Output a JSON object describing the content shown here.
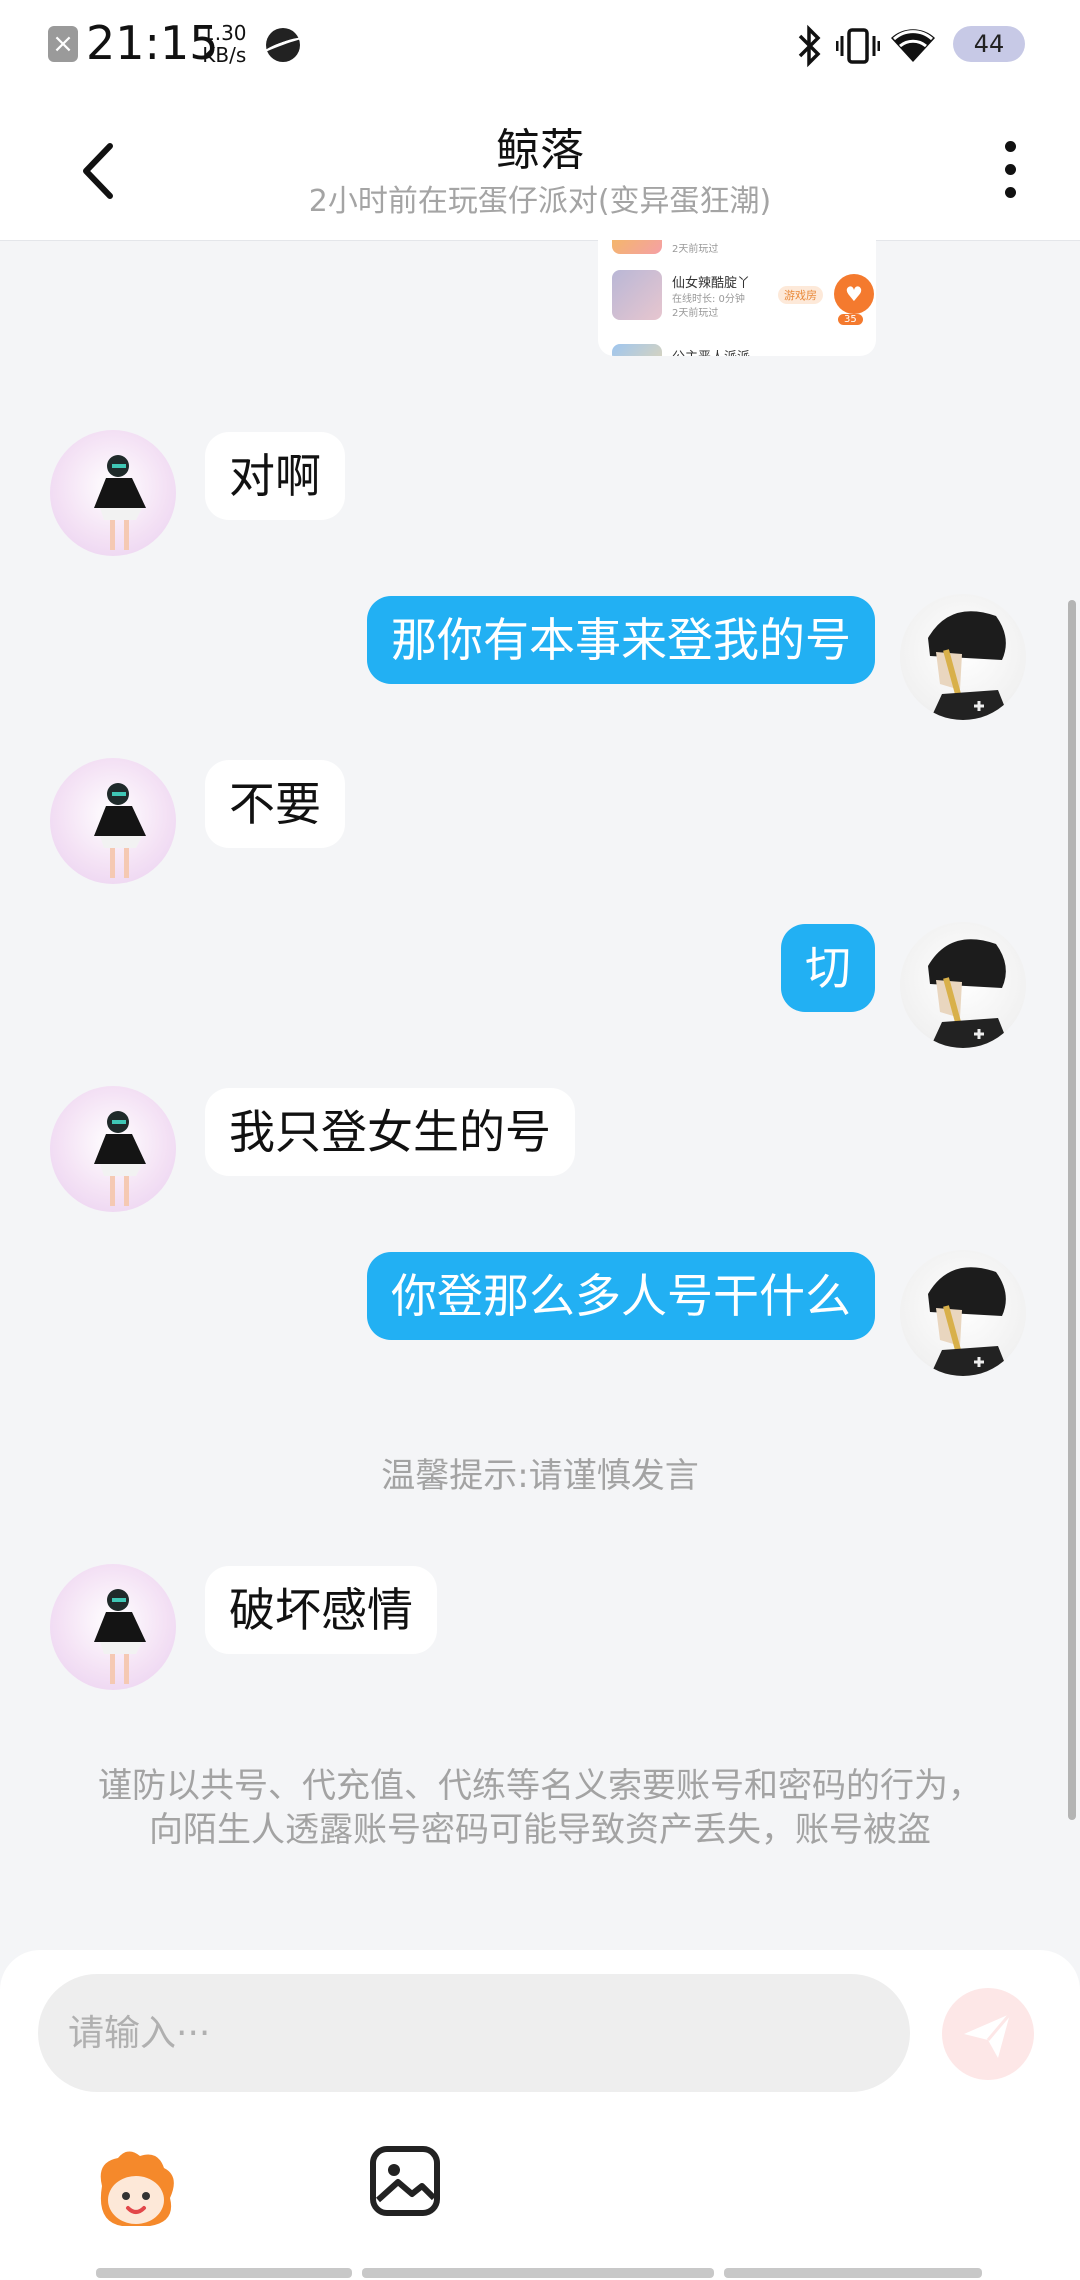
{
  "status_bar": {
    "time": "21:15",
    "speed_value": "1.30",
    "speed_unit": "KB/s",
    "battery": "44"
  },
  "header": {
    "title": "鲸落",
    "subtitle": "2小时前在玩蛋仔派对(变异蛋狂潮)"
  },
  "shared_card": {
    "top_sub": "2天前玩过",
    "item_name": "仙女辣酷腚丫",
    "item_sub1": "在线时长: 0分钟",
    "item_sub2": "2天前玩过",
    "tag": "游戏房",
    "like_count": "35",
    "bottom_name": "公主恶人派派"
  },
  "messages": [
    {
      "from": "them",
      "text": "对啊"
    },
    {
      "from": "me",
      "text": "那你有本事来登我的号"
    },
    {
      "from": "them",
      "text": "不要"
    },
    {
      "from": "me",
      "text": "切"
    },
    {
      "from": "them",
      "text": "我只登女生的号"
    },
    {
      "from": "me",
      "text": "你登那么多人号干什么"
    },
    {
      "from": "them",
      "text": "破坏感情"
    }
  ],
  "system_tip": "温馨提示:请谨慎发言",
  "security_warning": "谨防以共号、代充值、代练等名义索要账号和密码的行为，向陌生人透露账号密码可能导致资产丢失，账号被盗",
  "input": {
    "placeholder": "请输入···"
  },
  "colors": {
    "outgoing_bubble": "#22b0f3",
    "incoming_bubble": "#ffffff",
    "background": "#f4f5f7",
    "send_button": "#fde7e7"
  },
  "icons": [
    "back-arrow-icon",
    "more-vertical-icon",
    "send-icon",
    "emoji-mascot-icon",
    "image-icon",
    "bluetooth-icon",
    "vibrate-icon",
    "wifi-icon"
  ]
}
